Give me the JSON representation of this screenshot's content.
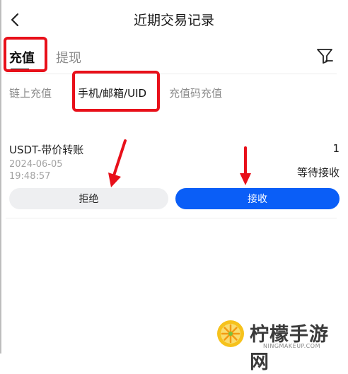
{
  "header": {
    "title": "近期交易记录",
    "back_icon": "chevron-left-icon"
  },
  "tabs": [
    {
      "label": "充值",
      "active": true
    },
    {
      "label": "提现",
      "active": false
    }
  ],
  "filter_icon": "filter-funnel-icon",
  "subtabs": [
    {
      "label": "链上充值",
      "active": false
    },
    {
      "label": "手机/邮箱/UID",
      "active": true
    },
    {
      "label": "充值码充值",
      "active": false
    }
  ],
  "record": {
    "title": "USDT-带价转账",
    "count": "1",
    "date": "2024-06-05",
    "time": "19:48:57",
    "status": "等待接收",
    "reject_label": "拒绝",
    "accept_label": "接收"
  },
  "annotations": {
    "highlight_color": "#e8101a"
  },
  "colors": {
    "accent": "#0a5ef7",
    "secondary_button": "#eeeff1",
    "muted_text": "#8a8a8a"
  },
  "watermark": {
    "text": "柠檬手游网",
    "subtext": "NINGMAKEUP.COM"
  }
}
